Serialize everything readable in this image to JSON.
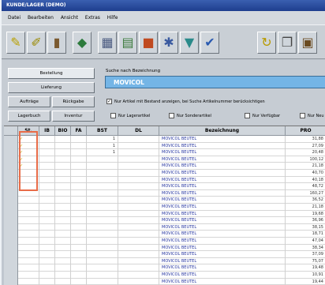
{
  "window": {
    "title": "KUNDE/LAGER (DEMO)"
  },
  "menu": [
    "Datei",
    "Bearbeiten",
    "Ansicht",
    "Extras",
    "Hilfe"
  ],
  "toolbar": {
    "icons": [
      "pencil-icon",
      "pencil-icon",
      "bottle-icon",
      "disk-icon",
      "building-icon",
      "chart-icon",
      "truck-icon",
      "gear-icon",
      "bottle-icon",
      "check-icon",
      "refresh-icon",
      "copy-icon",
      "print-icon"
    ]
  },
  "left_buttons": [
    {
      "label": "Bestellung",
      "active": true
    },
    {
      "label": "Lieferung",
      "active": false
    },
    {
      "label": "Aufträge",
      "active": false
    },
    {
      "label": "Rückgabe",
      "active": false
    },
    {
      "label": "Lagerbuch",
      "active": false
    },
    {
      "label": "Inventur",
      "active": false
    }
  ],
  "search": {
    "label": "Suche nach Bezeichnung",
    "value": "MOVICOL"
  },
  "options": {
    "main": "Nur Artikel mit Bestand anzeigen, bei Suche Artikelnummer berücksichtigen",
    "items": [
      "Nur Lagerartikel",
      "Nur Sonderartikel",
      "Nur Verfügbar",
      "Nur Neu"
    ]
  },
  "table": {
    "headers": [
      "St.",
      "IB",
      "BIO",
      "FA",
      "BST",
      "DL",
      "Bezeichnung",
      "PRO"
    ],
    "rows": [
      {
        "mark": "✓",
        "bst": "1",
        "desc": "MOVICOL BEUTEL",
        "price": "31,88"
      },
      {
        "mark": "✓",
        "bst": "1",
        "desc": "MOVICOL BEUTEL",
        "price": "27,09"
      },
      {
        "mark": "✓",
        "bst": "1",
        "desc": "MOVICOL BEUTEL",
        "price": "20,48"
      },
      {
        "mark": "✓",
        "bst": "",
        "desc": "MOVICOL BEUTEL",
        "price": "100,12"
      },
      {
        "mark": "✓",
        "bst": "",
        "desc": "MOVICOL BEUTEL",
        "price": "21,18"
      },
      {
        "mark": "",
        "bst": "",
        "desc": "MOVICOL BEUTEL",
        "price": "40,70"
      },
      {
        "mark": "",
        "bst": "",
        "desc": "MOVICOL BEUTEL",
        "price": "40,18"
      },
      {
        "mark": "",
        "bst": "",
        "desc": "MOVICOL BEUTEL",
        "price": "48,72"
      },
      {
        "mark": "",
        "bst": "",
        "desc": "MOVICOL BEUTEL",
        "price": "160,27"
      },
      {
        "mark": "",
        "bst": "",
        "desc": "MOVICOL BEUTEL",
        "price": "36,52"
      },
      {
        "mark": "",
        "bst": "",
        "desc": "MOVICOL BEUTEL",
        "price": "21,18"
      },
      {
        "mark": "",
        "bst": "",
        "desc": "MOVICOL BEUTEL",
        "price": "19,68"
      },
      {
        "mark": "",
        "bst": "",
        "desc": "MOVICOL BEUTEL",
        "price": "36,96"
      },
      {
        "mark": "",
        "bst": "",
        "desc": "MOVICOL BEUTEL",
        "price": "38,15"
      },
      {
        "mark": "",
        "bst": "",
        "desc": "MOVICOL BEUTEL",
        "price": "18,71"
      },
      {
        "mark": "",
        "bst": "",
        "desc": "MOVICOL BEUTEL",
        "price": "47,04"
      },
      {
        "mark": "",
        "bst": "",
        "desc": "MOVICOL BEUTEL",
        "price": "38,34"
      },
      {
        "mark": "",
        "bst": "",
        "desc": "MOVICOL BEUTEL",
        "price": "37,09"
      },
      {
        "mark": "",
        "bst": "",
        "desc": "MOVICOL BEUTEL",
        "price": "75,07"
      },
      {
        "mark": "",
        "bst": "",
        "desc": "MOVICOL BEUTEL",
        "price": "19,48"
      },
      {
        "mark": "",
        "bst": "",
        "desc": "MOVICOL BEUTEL",
        "price": "10,91"
      },
      {
        "mark": "",
        "bst": "",
        "desc": "MOVICOL BEUTEL",
        "price": "19,44"
      }
    ]
  },
  "colors": {
    "accent": "#74b5e6",
    "titlebar": "#2a4c9c",
    "highlight": "#e86c48"
  }
}
